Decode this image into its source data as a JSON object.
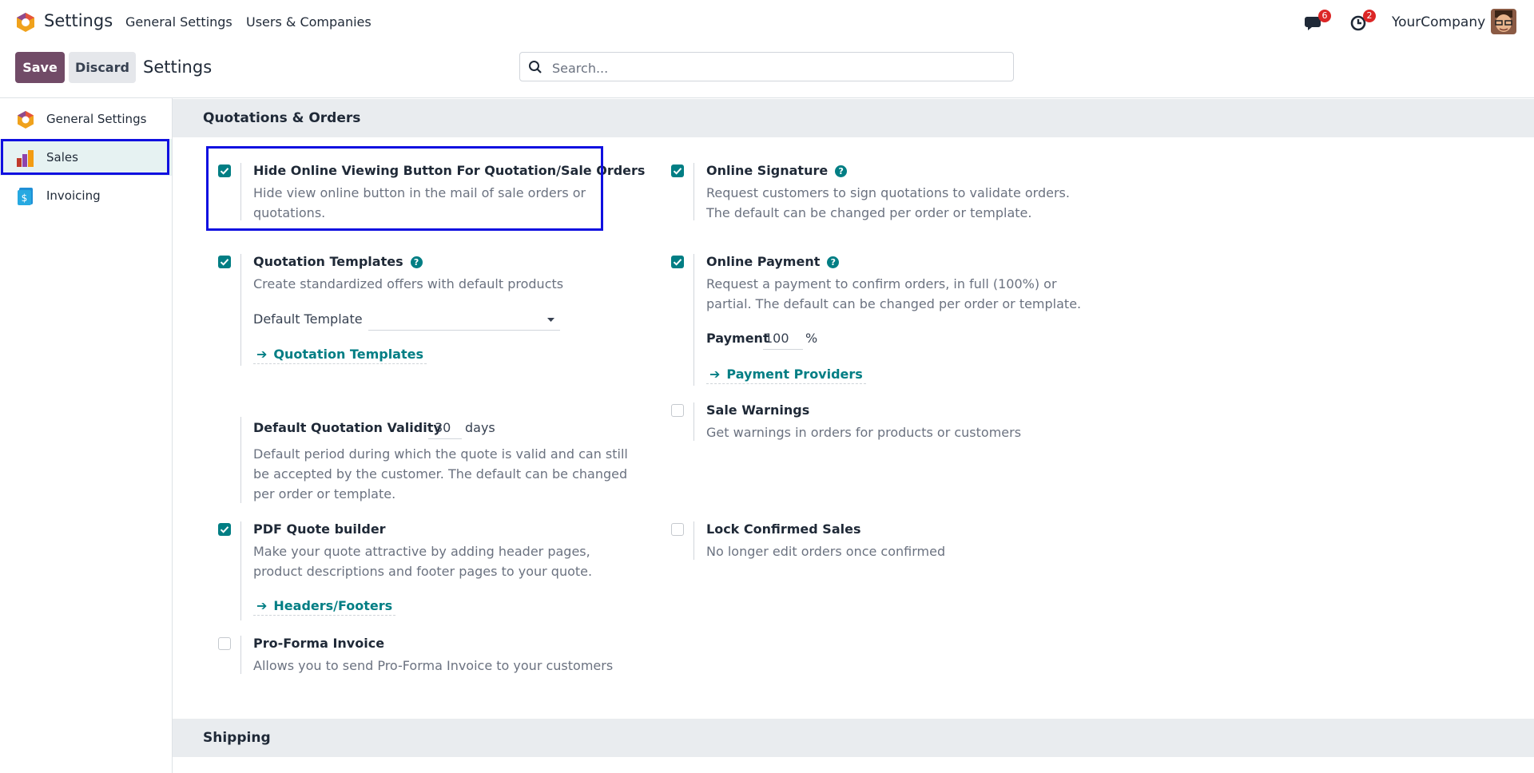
{
  "navbar": {
    "app_title": "Settings",
    "menu": [
      "General Settings",
      "Users & Companies"
    ],
    "messages_count": "6",
    "activities_count": "2",
    "company": "YourCompany"
  },
  "control": {
    "save_label": "Save",
    "discard_label": "Discard",
    "breadcrumb": "Settings",
    "search_placeholder": "Search..."
  },
  "sidebar": {
    "items": [
      {
        "label": "General Settings",
        "icon": "odoo-logo-icon"
      },
      {
        "label": "Sales",
        "icon": "sales-app-icon",
        "active": true
      },
      {
        "label": "Invoicing",
        "icon": "invoicing-app-icon"
      }
    ]
  },
  "sections": {
    "quotations": "Quotations & Orders",
    "shipping": "Shipping"
  },
  "settings": {
    "hide_online": {
      "title": "Hide Online Viewing Button For Quotation/Sale Orders",
      "desc": "Hide view online button in the mail of sale orders or quotations.",
      "checked": true
    },
    "online_signature": {
      "title": "Online Signature",
      "desc": "Request customers to sign quotations to validate orders. The default can be changed per order or template.",
      "checked": true
    },
    "quotation_templates": {
      "title": "Quotation Templates",
      "desc": "Create standardized offers with default products",
      "checked": true,
      "field_label": "Default Template",
      "field_value": "",
      "link": "Quotation Templates"
    },
    "online_payment": {
      "title": "Online Payment",
      "desc": "Request a payment to confirm orders, in full (100%) or partial. The default can be changed per order or template.",
      "checked": true,
      "field_label": "Payment",
      "field_value": "100",
      "field_unit": "%",
      "link": "Payment Providers"
    },
    "sale_warnings": {
      "title": "Sale Warnings",
      "desc": "Get warnings in orders for products or customers",
      "checked": false
    },
    "quotation_validity": {
      "title": "Default Quotation Validity",
      "value": "30",
      "unit": "days",
      "desc": "Default period during which the quote is valid and can still be accepted by the customer. The default can be changed per order or template."
    },
    "pdf_builder": {
      "title": "PDF Quote builder",
      "desc": "Make your quote attractive by adding header pages, product descriptions and footer pages to your quote.",
      "checked": true,
      "link": "Headers/Footers"
    },
    "lock_confirmed": {
      "title": "Lock Confirmed Sales",
      "desc": "No longer edit orders once confirmed",
      "checked": false
    },
    "proforma": {
      "title": "Pro-Forma Invoice",
      "desc": "Allows you to send Pro-Forma Invoice to your customers",
      "checked": false
    }
  },
  "colors": {
    "brand": "#714b67",
    "accent": "#017e84",
    "highlight_box": "#1010e0"
  }
}
